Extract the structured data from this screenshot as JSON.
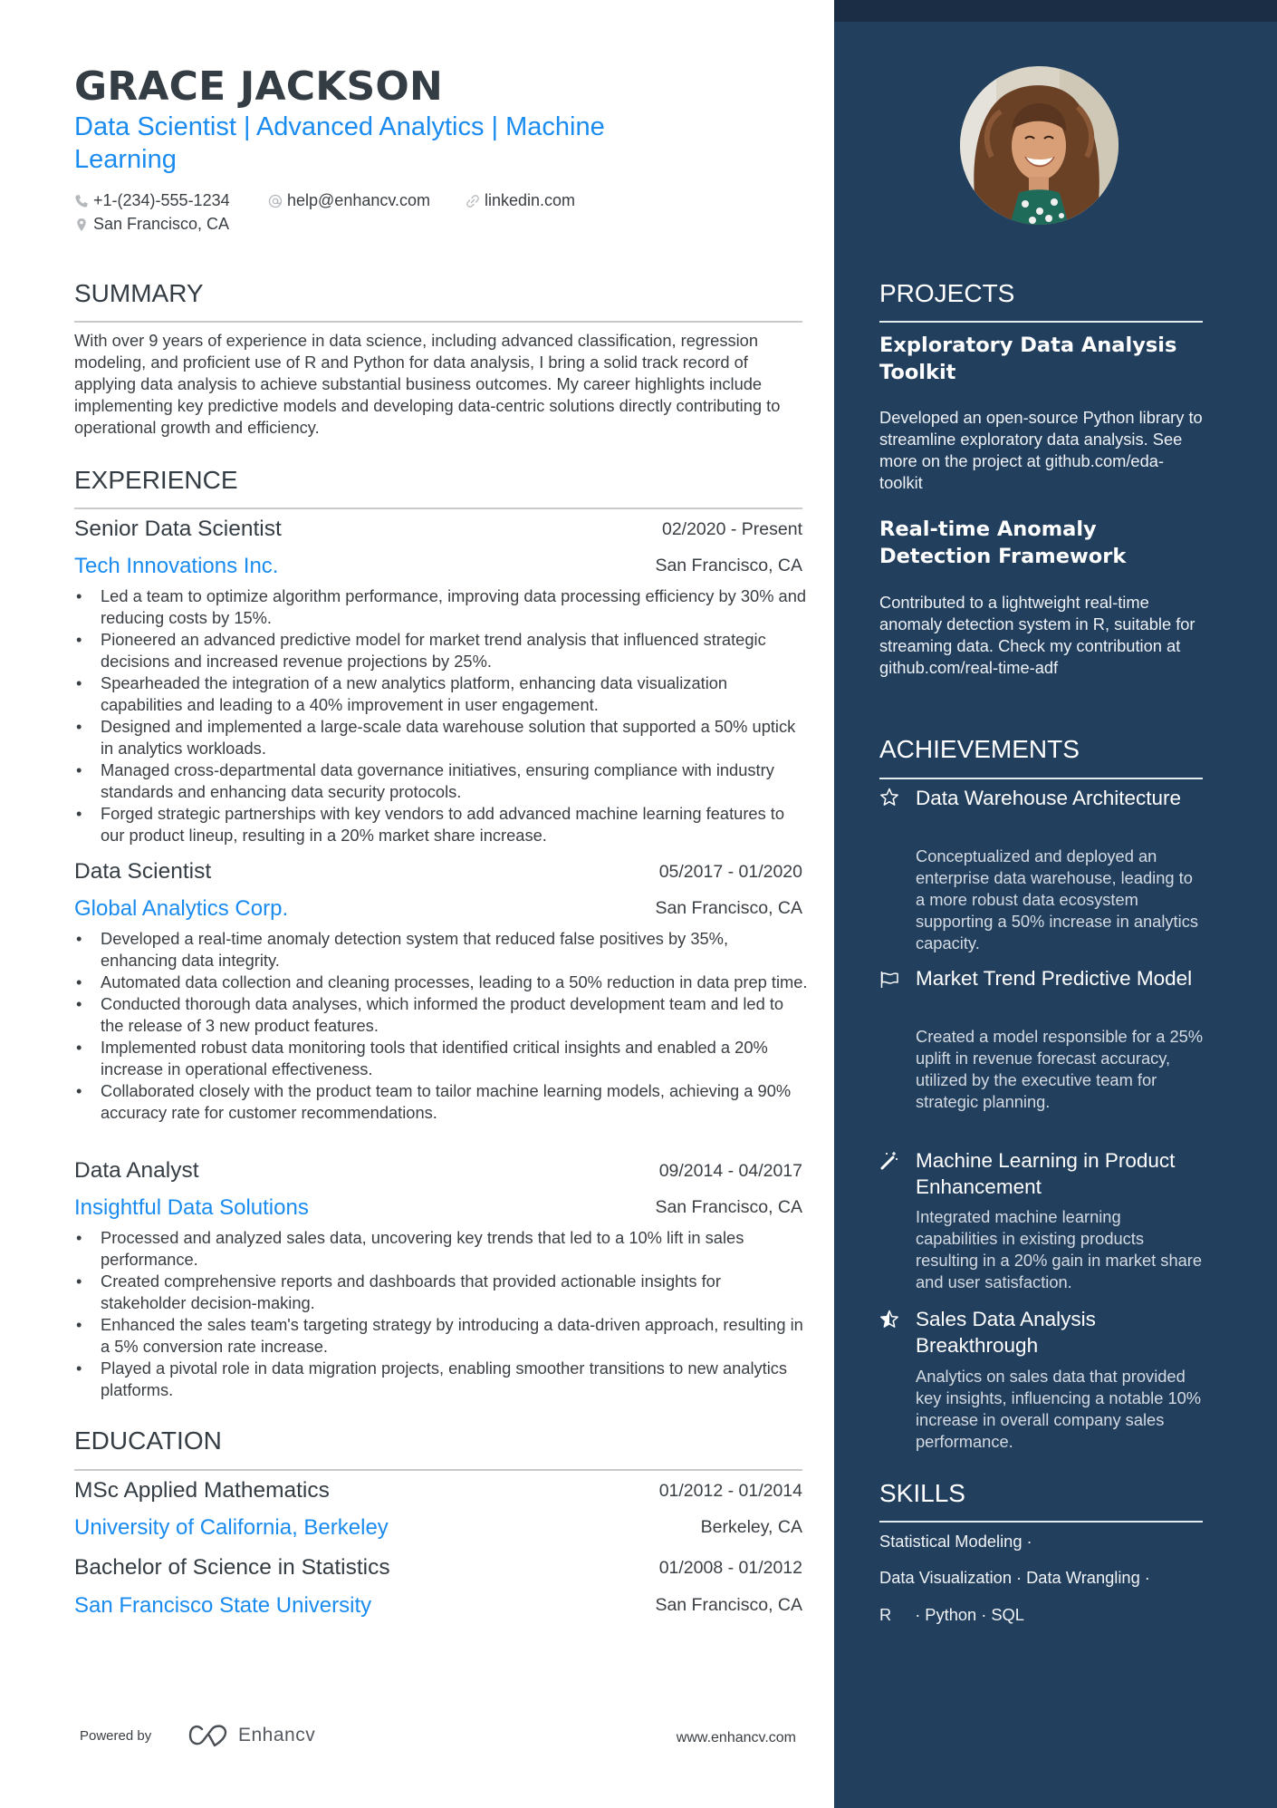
{
  "header": {
    "name": "GRACE JACKSON",
    "title_line1": "Data Scientist | Advanced Analytics | Machine",
    "title_line2": "Learning",
    "phone": "+1-(234)-555-1234",
    "email": "help@enhancv.com",
    "linkedin": "linkedin.com",
    "location": "San Francisco, CA"
  },
  "summary": {
    "title": "SUMMARY",
    "text": "With over 9 years of experience in data science, including advanced classification, regression modeling, and proficient use of R and Python for data analysis, I bring a solid track record of applying data analysis to achieve substantial business outcomes. My career highlights include implementing key predictive models and developing data-centric solutions directly contributing to operational growth and efficiency."
  },
  "experience": {
    "title": "EXPERIENCE",
    "jobs": [
      {
        "role": "Senior Data Scientist",
        "dates": "02/2020 - Present",
        "company": "Tech Innovations Inc.",
        "location": "San Francisco, CA",
        "bullets": [
          "Led a team to optimize algorithm performance, improving data processing efficiency by 30% and reducing costs by 15%.",
          "Pioneered an advanced predictive model for market trend analysis that influenced strategic decisions and increased revenue projections by 25%.",
          "Spearheaded the integration of a new analytics platform, enhancing data visualization capabilities and leading to a 40% improvement in user engagement.",
          "Designed and implemented a large-scale data warehouse solution that supported a 50% uptick in analytics workloads.",
          "Managed cross-departmental data governance initiatives, ensuring compliance with industry standards and enhancing data security protocols.",
          "Forged strategic partnerships with key vendors to add advanced machine learning features to our product lineup, resulting in a 20% market share increase."
        ]
      },
      {
        "role": "Data Scientist",
        "dates": "05/2017 - 01/2020",
        "company": "Global Analytics Corp.",
        "location": "San Francisco, CA",
        "bullets": [
          "Developed a real-time anomaly detection system that reduced false positives by 35%, enhancing data integrity.",
          "Automated data collection and cleaning processes, leading to a 50% reduction in data prep time.",
          "Conducted thorough data analyses, which informed the product development team and led to the release of 3 new product features.",
          "Implemented robust data monitoring tools that identified critical insights and enabled a 20% increase in operational effectiveness.",
          "Collaborated closely with the product team to tailor machine learning models, achieving a 90% accuracy rate for customer recommendations."
        ]
      },
      {
        "role": "Data Analyst",
        "dates": "09/2014 - 04/2017",
        "company": "Insightful Data Solutions",
        "location": "San Francisco, CA",
        "bullets": [
          "Processed and analyzed sales data, uncovering key trends that led to a 10% lift in sales performance.",
          "Created comprehensive reports and dashboards that provided actionable insights for stakeholder decision-making.",
          "Enhanced the sales team's targeting strategy by introducing a data-driven approach, resulting in a 5% conversion rate increase.",
          "Played a pivotal role in data migration projects, enabling smoother transitions to new analytics platforms."
        ]
      }
    ]
  },
  "education": {
    "title": "EDUCATION",
    "items": [
      {
        "degree": "MSc Applied Mathematics",
        "dates": "01/2012 - 01/2014",
        "school": "University of California, Berkeley",
        "location": "Berkeley, CA"
      },
      {
        "degree": "Bachelor of Science in Statistics",
        "dates": "01/2008 - 01/2012",
        "school": "San Francisco State University",
        "location": "San Francisco, CA"
      }
    ]
  },
  "footer": {
    "powered_by": "Powered by",
    "brand": "Enhancv",
    "url": "www.enhancv.com"
  },
  "projects": {
    "title": "PROJECTS",
    "items": [
      {
        "title": "Exploratory Data Analysis Toolkit",
        "description": "Developed an open-source Python library to streamline exploratory data analysis. See more on the project at github.com/eda-toolkit"
      },
      {
        "title": "Real-time Anomaly Detection Framework",
        "description": "Contributed to a lightweight real-time anomaly detection system in R, suitable for streaming data. Check my contribution at github.com/real-time-adf"
      }
    ]
  },
  "achievements": {
    "title": "ACHIEVEMENTS",
    "items": [
      {
        "icon": "star-outline-icon",
        "title": "Data Warehouse Architecture",
        "description": "Conceptualized and deployed an enterprise data warehouse, leading to a more robust data ecosystem supporting a 50% increase in analytics capacity."
      },
      {
        "icon": "flag-icon",
        "title": "Market Trend Predictive Model",
        "description": "Created a model responsible for a 25% uplift in revenue forecast accuracy, utilized by the executive team for strategic planning."
      },
      {
        "icon": "magic-wand-icon",
        "title": "Machine Learning in Product Enhancement",
        "description": "Integrated machine learning capabilities in existing products resulting in a 20% gain in market share and user satisfaction."
      },
      {
        "icon": "star-half-icon",
        "title": "Sales Data Analysis Breakthrough",
        "description": "Analytics on sales data that provided key insights, influencing a notable 10% increase in overall company sales performance."
      }
    ]
  },
  "skills": {
    "title": "SKILLS",
    "rows": [
      [
        "Statistical Modeling"
      ],
      [
        "Data Visualization",
        "Data Wrangling"
      ],
      [
        "R",
        "Python",
        "SQL"
      ]
    ],
    "separator": "·"
  },
  "colors": {
    "accent": "#1a8cf0",
    "sidebar": "#233f5e",
    "sidebar_top": "#1b2d45",
    "text": "#3a3f44"
  }
}
